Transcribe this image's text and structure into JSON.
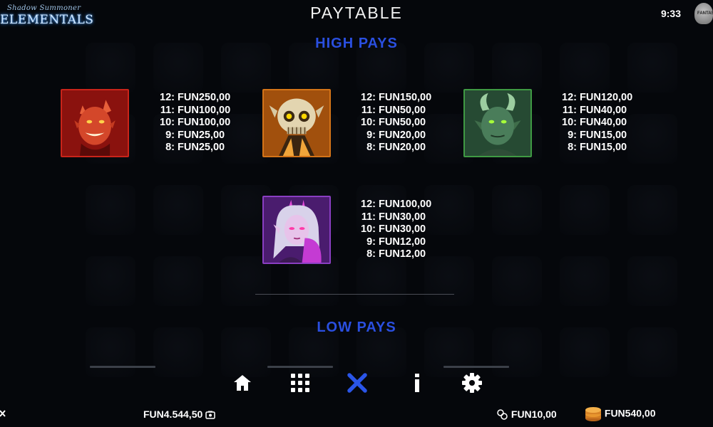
{
  "header": {
    "logo_subtitle": "Shadow Summoner",
    "logo_title": "ELEMENTALS",
    "title": "PAYTABLE",
    "clock": "9:33"
  },
  "sections": {
    "high": "HIGH PAYS",
    "low": "LOW PAYS"
  },
  "high_pays": [
    {
      "symbol": "red-devil-icon",
      "color": "#d12a1e",
      "pays": [
        {
          "count": "12:",
          "value": "FUN250,00"
        },
        {
          "count": "11:",
          "value": "FUN100,00"
        },
        {
          "count": "10:",
          "value": "FUN100,00"
        },
        {
          "count": "9:",
          "value": "FUN25,00"
        },
        {
          "count": "8:",
          "value": "FUN25,00"
        }
      ]
    },
    {
      "symbol": "skull-imp-icon",
      "color": "#d9791a",
      "pays": [
        {
          "count": "12:",
          "value": "FUN150,00"
        },
        {
          "count": "11:",
          "value": "FUN50,00"
        },
        {
          "count": "10:",
          "value": "FUN50,00"
        },
        {
          "count": "9:",
          "value": "FUN20,00"
        },
        {
          "count": "8:",
          "value": "FUN20,00"
        }
      ]
    },
    {
      "symbol": "green-demon-icon",
      "color": "#3a9a3f",
      "pays": [
        {
          "count": "12:",
          "value": "FUN120,00"
        },
        {
          "count": "11:",
          "value": "FUN40,00"
        },
        {
          "count": "10:",
          "value": "FUN40,00"
        },
        {
          "count": "9:",
          "value": "FUN15,00"
        },
        {
          "count": "8:",
          "value": "FUN15,00"
        }
      ]
    },
    {
      "symbol": "purple-succubus-icon",
      "color": "#8c3fc4",
      "pays": [
        {
          "count": "12:",
          "value": "FUN100,00"
        },
        {
          "count": "11:",
          "value": "FUN30,00"
        },
        {
          "count": "10:",
          "value": "FUN30,00"
        },
        {
          "count": "9:",
          "value": "FUN12,00"
        },
        {
          "count": "8:",
          "value": "FUN12,00"
        }
      ]
    }
  ],
  "nav": {
    "home_icon": "home-icon",
    "grid_icon": "grid-icon",
    "close_icon": "close-icon",
    "info_icon": "info-icon",
    "settings_icon": "gear-icon",
    "close_color": "#2a55e8"
  },
  "footer": {
    "balance": "FUN4.544,50",
    "bet": "FUN10,00",
    "win": "FUN540,00"
  }
}
